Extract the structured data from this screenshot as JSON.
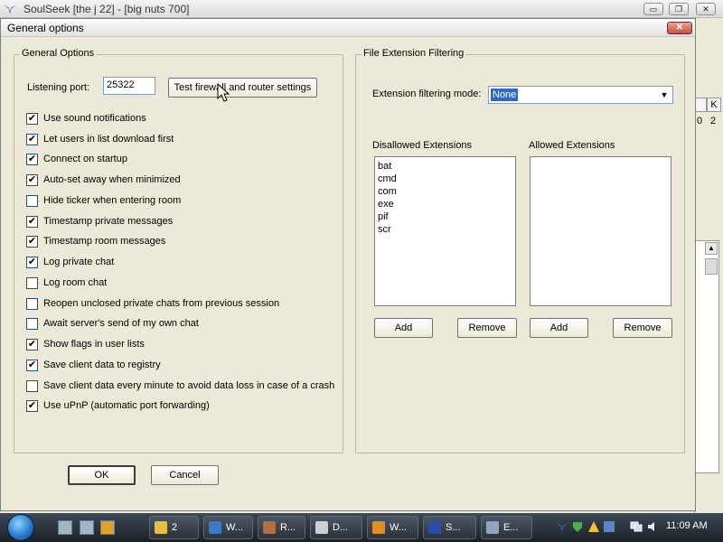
{
  "app": {
    "title": "SoulSeek [the j 22] - [big nuts 700]",
    "controls": {
      "minimize": "▭",
      "maximize": "❐",
      "close": "✕"
    }
  },
  "background": {
    "columns": [
      "",
      "K"
    ],
    "cells": [
      "0",
      "2"
    ]
  },
  "dialog": {
    "title": "General options",
    "close_label": "✕",
    "general": {
      "group_label": "General Options",
      "listening_port_label": "Listening port:",
      "listening_port_value": "25322",
      "test_button": "Test firewall and router settings",
      "options": [
        {
          "label": "Use sound notifications",
          "checked": "✔"
        },
        {
          "label": "Let users in list download first",
          "checked": "✔"
        },
        {
          "label": "Connect on startup",
          "checked": "✔"
        },
        {
          "label": "Auto-set away when minimized",
          "checked": "✔"
        },
        {
          "label": "Hide ticker when entering room",
          "checked": ""
        },
        {
          "label": "Timestamp private messages",
          "checked": "✔"
        },
        {
          "label": "Timestamp room messages",
          "checked": "✔"
        },
        {
          "label": "Log private chat",
          "checked": "✔"
        },
        {
          "label": "Log room chat",
          "checked": ""
        },
        {
          "label": "Reopen unclosed private chats from previous session",
          "checked": ""
        },
        {
          "label": "Await server's send of my own chat",
          "checked": ""
        },
        {
          "label": "Show flags in user lists",
          "checked": "✔"
        },
        {
          "label": "Save client data to registry",
          "checked": "✔"
        },
        {
          "label": "Save client data every minute to avoid data loss in case of a crash",
          "checked": ""
        },
        {
          "label": "Use uPnP (automatic port forwarding)",
          "checked": "✔"
        }
      ]
    },
    "filtering": {
      "group_label": "File Extension Filtering",
      "mode_label": "Extension filtering mode:",
      "mode_value": "None",
      "disallowed_label": "Disallowed Extensions",
      "allowed_label": "Allowed Extensions",
      "disallowed": [
        "bat",
        "cmd",
        "com",
        "exe",
        "pif",
        "scr"
      ],
      "allowed": [],
      "add_label": "Add",
      "remove_label": "Remove"
    },
    "ok_label": "OK",
    "cancel_label": "Cancel"
  },
  "taskbar": {
    "tasks": [
      {
        "label": "2",
        "icon_color": "#e8c040"
      },
      {
        "label": "W...",
        "icon_color": "#3a78c8"
      },
      {
        "label": "R...",
        "icon_color": "#b07040"
      },
      {
        "label": "D...",
        "icon_color": "#cfcfcf"
      },
      {
        "label": "W...",
        "icon_color": "#e09020"
      },
      {
        "label": "S...",
        "icon_color": "#2a4fa8"
      },
      {
        "label": "E...",
        "icon_color": "#8fa6c0"
      }
    ],
    "clock": "11:09 AM"
  }
}
